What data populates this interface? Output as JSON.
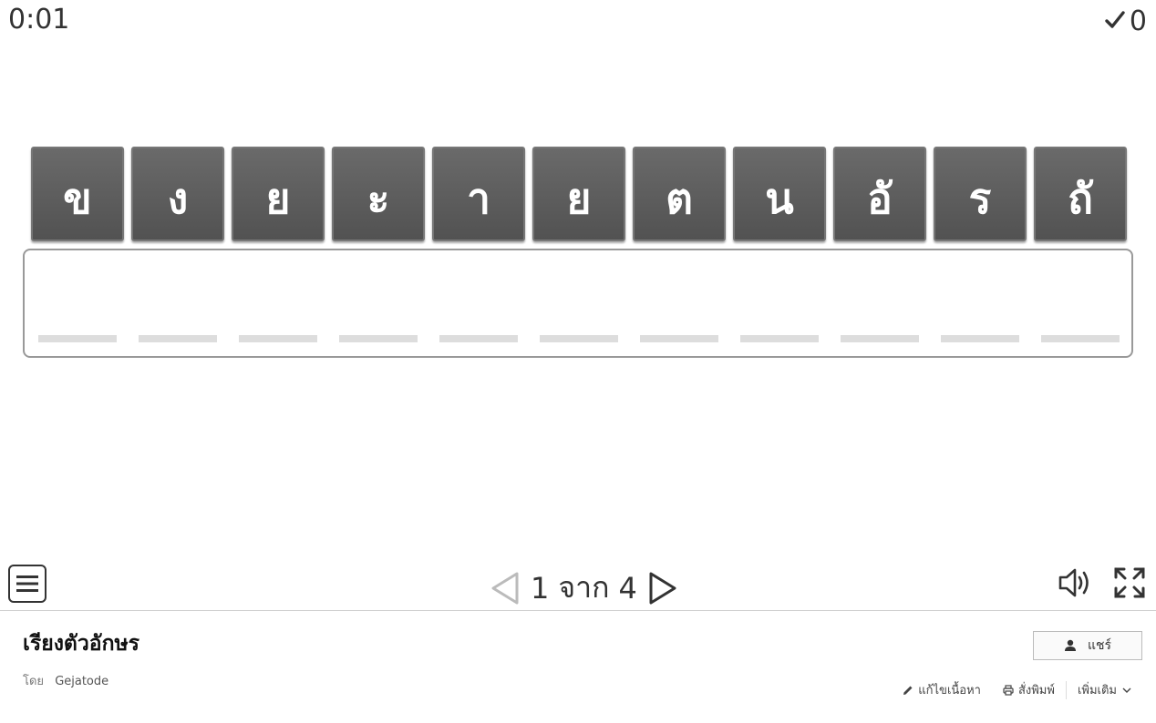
{
  "game": {
    "timer": "0:01",
    "score": "0",
    "tiles": [
      "ข",
      "ง",
      "ย",
      "ะ",
      "า",
      "ย",
      "ต",
      "น",
      "อั",
      "ร",
      "ถั"
    ],
    "slot_count": 11
  },
  "controls": {
    "page_current": "1",
    "page_of_word": "จาก",
    "page_total": "4"
  },
  "footer": {
    "title": "เรียงตัวอักษร",
    "by_label": "โดย",
    "author": "Gejatode",
    "share_label": "แชร์",
    "edit_label": "แก้ไขเนื้อหา",
    "print_label": "สั่งพิมพ์",
    "more_label": "เพิ่มเติม"
  }
}
